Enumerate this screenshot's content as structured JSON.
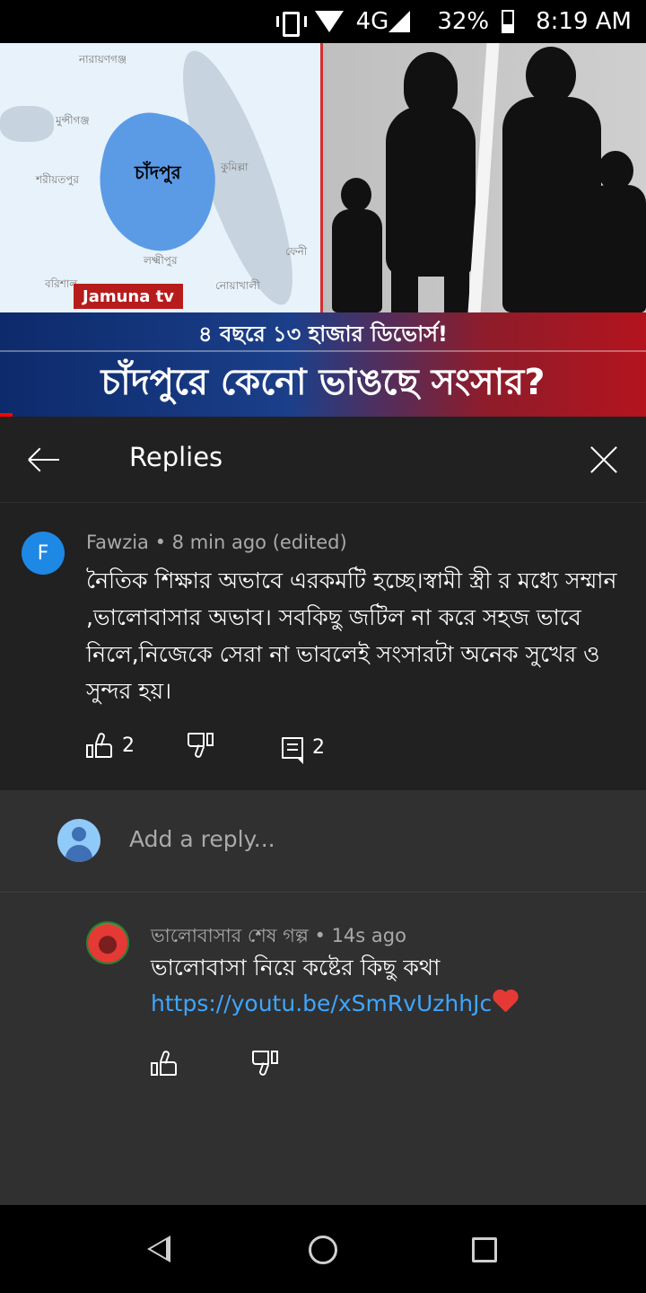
{
  "status_bar": {
    "network": "4G",
    "battery": "32%",
    "time": "8:19 AM"
  },
  "video": {
    "map_labels": [
      "নারায়ণগঞ্জ",
      "মুন্সীগঞ্জ",
      "শরীয়তপুর",
      "কুমিল্লা",
      "লক্ষ্মীপুর",
      "ফেনী",
      "বরিশাল",
      "নোয়াখালী"
    ],
    "map_main_label": "চাঁদপুর",
    "channel_badge": "Jamuna tv",
    "headline_small": "৪ বছরে ১৩ হাজার ডিভোর্স!",
    "headline_large": "চাঁদপুরে কেনো ভাঙছে সংসার?"
  },
  "header": {
    "title": "Replies"
  },
  "comment": {
    "avatar_letter": "F",
    "meta": "Fawzia • 8 min ago (edited)",
    "text": "নৈতিক শিক্ষার অভাবে এরকমটি হচ্ছে।স্বামী স্ত্রী র মধ্যে সম্মান ,ভালোবাসার অভাব। সবকিছু জটিল না করে সহজ ভাবে নিলে,নিজেকে সেরা না ভাবলেই সংসারটা অনেক সুখের ও সুন্দর হয়।",
    "likes": "2",
    "replies": "2"
  },
  "add_reply": {
    "placeholder": "Add a reply..."
  },
  "reply": {
    "meta": "ভালোবাসার শেষ গল্প • 14s ago",
    "text": "ভালোবাসা নিয়ে কষ্টের কিছু কথা",
    "link": "https://youtu.be/xSmRvUzhhJc"
  },
  "colors": {
    "background": "#212121",
    "reply_bg": "#303030",
    "link": "#3ea6ff",
    "avatar": "#1e88e5"
  }
}
